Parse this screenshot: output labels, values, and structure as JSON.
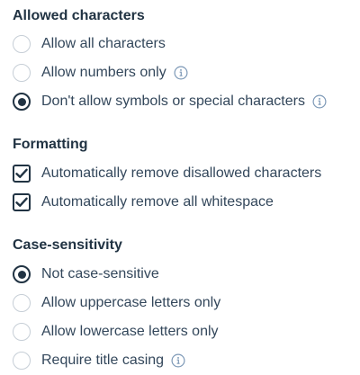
{
  "sections": {
    "allowed": {
      "title": "Allowed characters",
      "options": [
        {
          "label": "Allow all characters",
          "selected": false,
          "info": false
        },
        {
          "label": "Allow numbers only",
          "selected": false,
          "info": true
        },
        {
          "label": "Don't allow symbols or special characters",
          "selected": true,
          "info": true
        }
      ]
    },
    "formatting": {
      "title": "Formatting",
      "options": [
        {
          "label": "Automatically remove disallowed characters",
          "checked": true
        },
        {
          "label": "Automatically remove all whitespace",
          "checked": true
        }
      ]
    },
    "case": {
      "title": "Case-sensitivity",
      "options": [
        {
          "label": "Not case-sensitive",
          "selected": true,
          "info": false
        },
        {
          "label": "Allow uppercase letters only",
          "selected": false,
          "info": false
        },
        {
          "label": "Allow lowercase letters only",
          "selected": false,
          "info": false
        },
        {
          "label": "Require title casing",
          "selected": false,
          "info": true
        }
      ]
    }
  },
  "icons": {
    "info": "info-icon",
    "check": "checkmark-icon"
  },
  "colors": {
    "text": "#33475b",
    "heading": "#213343",
    "control_border": "#c6ced6",
    "control_selected": "#213343"
  }
}
